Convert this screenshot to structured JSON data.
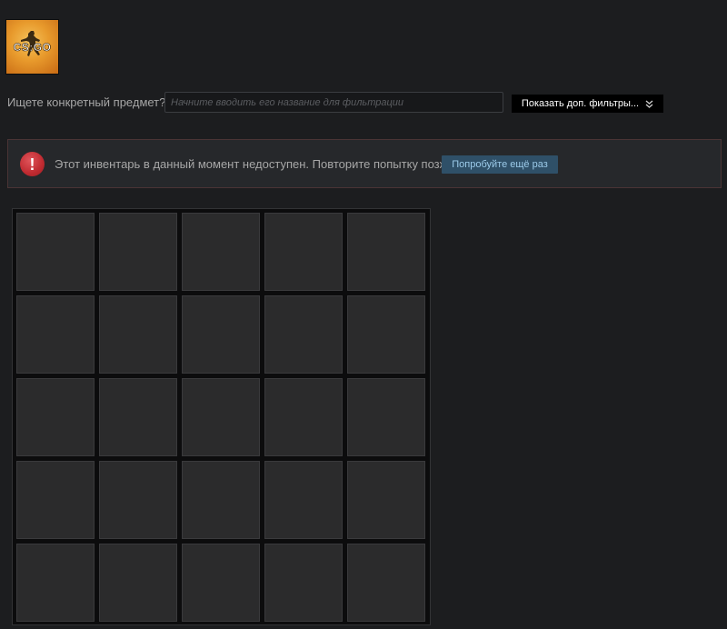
{
  "game": {
    "logo_text": "CS:GO",
    "icon": "csgo-logo-icon"
  },
  "filter": {
    "label": "Ищете конкретный предмет?",
    "placeholder": "Начните вводить его название для фильтрации",
    "value": "",
    "more_filters_label": "Показать доп. фильтры...",
    "more_filters_icon": "double-chevron-down-icon"
  },
  "error": {
    "icon": "alert-icon",
    "icon_glyph": "!",
    "message": "Этот инвентарь в данный момент недоступен. Повторите попытку позже.",
    "retry_label": "Попробуйте ещё раз"
  },
  "inventory": {
    "rows": 5,
    "columns": 5,
    "slots_filled": 0
  },
  "colors": {
    "page_background": "#1c1d1f",
    "error_icon": "#bf2a30",
    "retry_button": "#2f5068",
    "retry_text": "#9ccbea",
    "slot_background": "#2b2b2c"
  }
}
